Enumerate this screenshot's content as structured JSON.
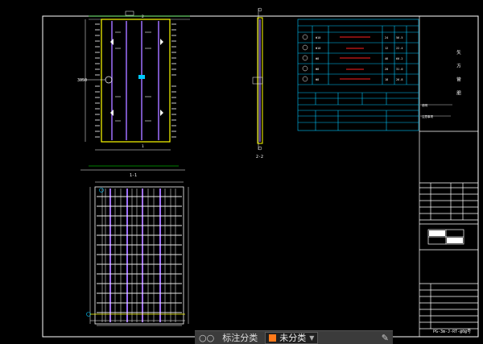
{
  "drawing": {
    "sheet_title_vertical": "矢 方 管 肥",
    "drawing_number": "PG-3m-J-RT-@0@号",
    "section_labels": {
      "plan_bottom": "1-1",
      "side_view": "2-2",
      "callout_left": "1",
      "callout_right": "2"
    },
    "note_labels": {
      "note_1": "说明",
      "note_2": "注意事项"
    }
  },
  "colors": {
    "background": "#000000",
    "frame": "#ffffff",
    "table": "#00c8ff",
    "rebar": "#ffff00",
    "purple": "#a070ff",
    "green": "#00ff00",
    "red": "#ff2020",
    "layer_swatch": "#ff7a1a"
  },
  "status_bar": {
    "left_icon": "layer-properties-icon",
    "layer_label": "标注分类",
    "current_layer": "未分类",
    "right_icon": "edit-icon"
  }
}
